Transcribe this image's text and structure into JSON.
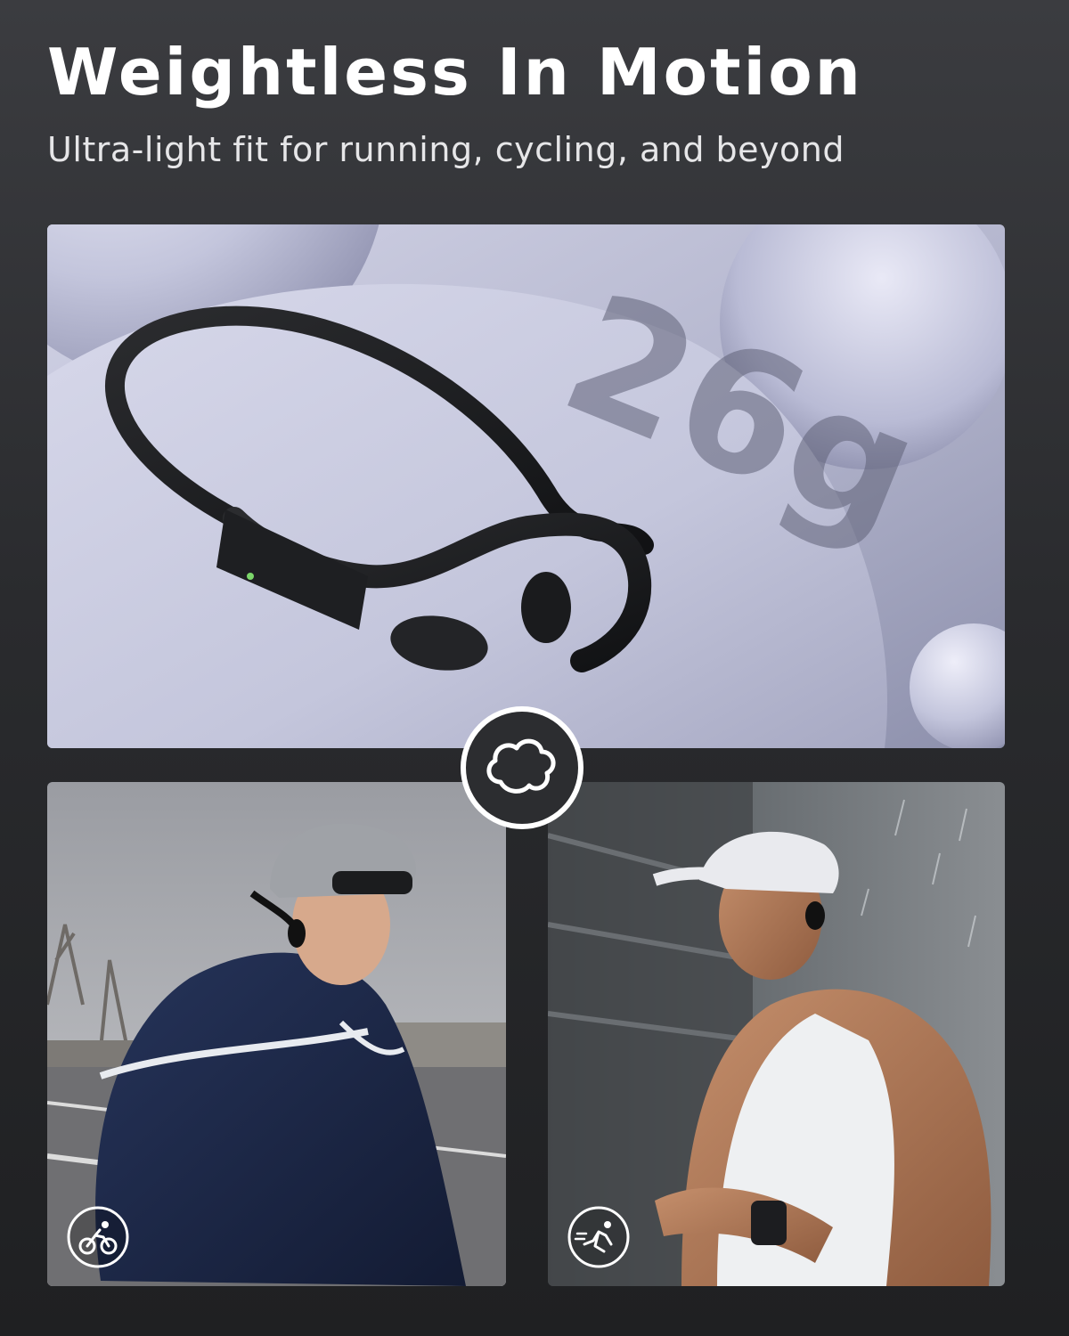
{
  "header": {
    "title": "Weightless In Motion",
    "subtitle": "Ultra-light fit for running, cycling, and beyond"
  },
  "hero": {
    "weight_label": "26g",
    "band_color": "#1b1c1e",
    "surface_color": "#c9cadf"
  },
  "badges": {
    "center_icon": "lightweight-cloud-icon",
    "cycling_icon": "cycling-icon",
    "running_icon": "running-icon"
  },
  "photos": {
    "left_subject": "cyclist-photo",
    "right_subject": "runner-photo"
  },
  "colors": {
    "background_top": "#3b3c40",
    "background_bottom": "#1f2022",
    "accent_white": "#ffffff"
  }
}
